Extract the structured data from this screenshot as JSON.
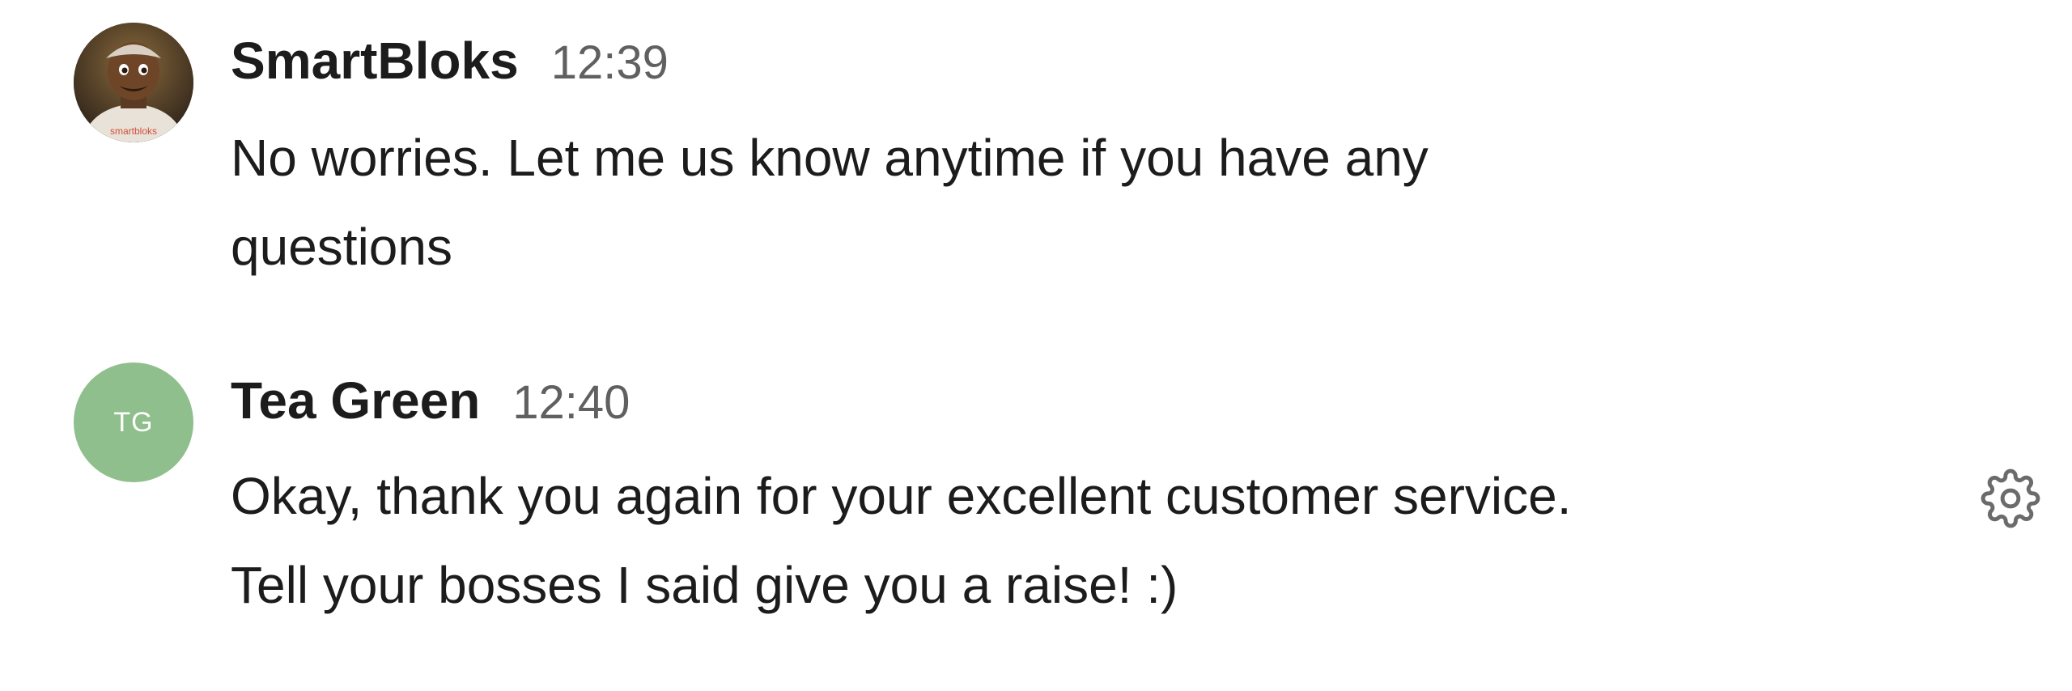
{
  "messages": [
    {
      "author": "SmartBloks",
      "time": "12:39",
      "lines": [
        "No worries. Let me us know anytime if you have any",
        "questions"
      ],
      "avatar": {
        "type": "photo",
        "logo_text": "smartbloks"
      }
    },
    {
      "author": "Tea Green",
      "time": "12:40",
      "lines": [
        "Okay, thank you again for your excellent customer service.",
        "Tell your bosses I said give you a raise! :)"
      ],
      "avatar": {
        "type": "initials",
        "initials": "TG",
        "color": "#8fbf8c"
      }
    }
  ],
  "actions": {
    "settings_icon": "gear-icon"
  }
}
